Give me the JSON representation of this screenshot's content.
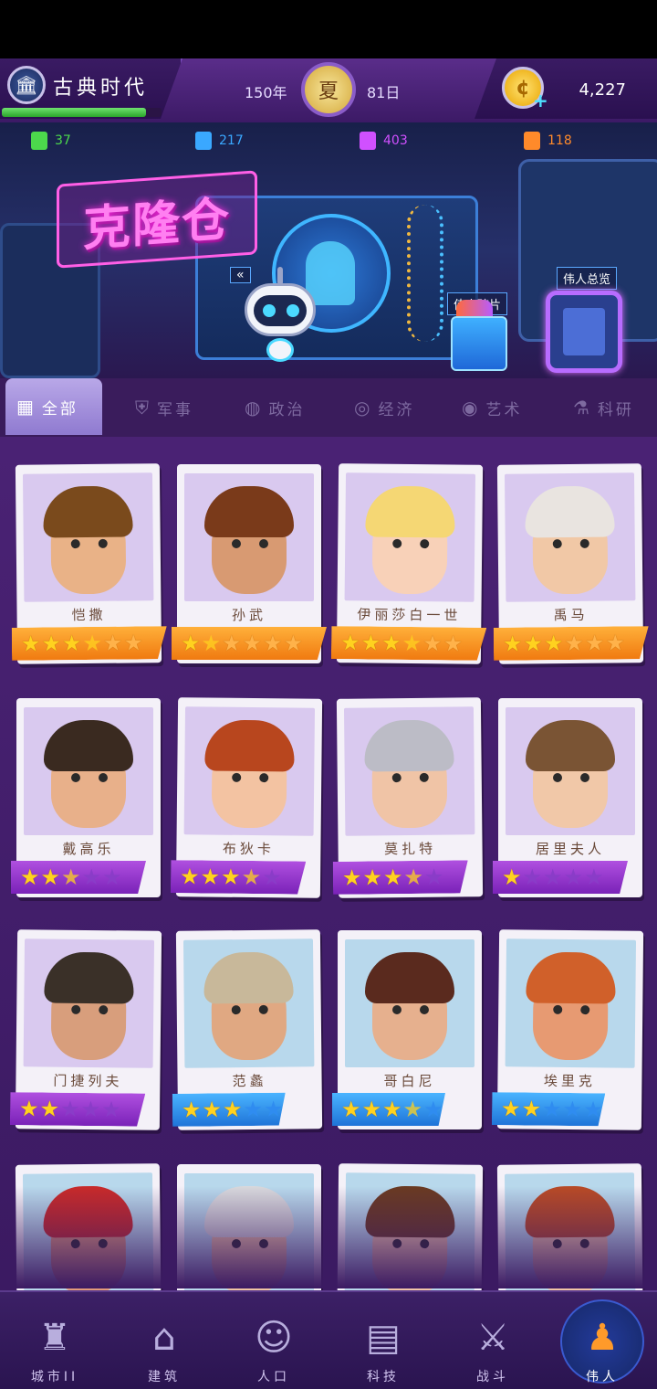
{
  "header": {
    "era_name": "古典时代",
    "era_progress": 0.9,
    "year": "150年",
    "season": "夏",
    "day": "81日",
    "coins": "4,227"
  },
  "resources": [
    {
      "value": "37",
      "color": "#4cd84c"
    },
    {
      "value": "217",
      "color": "#3aa8ff"
    },
    {
      "value": "403",
      "color": "#d050ff"
    },
    {
      "value": "118",
      "color": "#ff8a2a"
    }
  ],
  "banner": {
    "title": "克隆仓",
    "fragment_label": "伟人碎片",
    "overview_label": "伟人总览",
    "robot_chip": "«"
  },
  "tabs": [
    {
      "label": "全部",
      "icon": "grid-icon"
    },
    {
      "label": "军事",
      "icon": "shield-icon"
    },
    {
      "label": "政治",
      "icon": "globe-icon"
    },
    {
      "label": "经济",
      "icon": "coins-icon"
    },
    {
      "label": "艺术",
      "icon": "palette-icon"
    },
    {
      "label": "科研",
      "icon": "microscope-icon"
    }
  ],
  "heroes": [
    {
      "name": "恺撒",
      "tier": "orange",
      "stars": 3.5,
      "hair": "#7a4a1c",
      "skin": "#e9b287",
      "bg": "#d9c9ef"
    },
    {
      "name": "孙武",
      "tier": "orange",
      "stars": 1.5,
      "hair": "#7a3a1a",
      "skin": "#d89a72",
      "bg": "#d9c9ef"
    },
    {
      "name": "伊丽莎白一世",
      "tier": "orange",
      "stars": 3.5,
      "hair": "#f5d774",
      "skin": "#f8d1b8",
      "bg": "#d9c9ef"
    },
    {
      "name": "禹马",
      "tier": "orange",
      "stars": 3,
      "hair": "#e9e4e0",
      "skin": "#f1c8a6",
      "bg": "#d9c9ef"
    },
    {
      "name": "戴高乐",
      "tier": "purple",
      "stars": 2.5,
      "hair": "#3a2a20",
      "skin": "#e8b08a",
      "bg": "#d9c9ef"
    },
    {
      "name": "布狄卡",
      "tier": "purple",
      "stars": 3.5,
      "hair": "#b8461e",
      "skin": "#f3c3a2",
      "bg": "#d9c9ef"
    },
    {
      "name": "莫扎特",
      "tier": "purple",
      "stars": 3.5,
      "hair": "#bcbcc6",
      "skin": "#f0c4a6",
      "bg": "#d9c9ef"
    },
    {
      "name": "居里夫人",
      "tier": "purple",
      "stars": 1,
      "hair": "#7a5434",
      "skin": "#f1c8a8",
      "bg": "#d9c9ef"
    },
    {
      "name": "门捷列夫",
      "tier": "purple",
      "stars": 2,
      "hair": "#3a3028",
      "skin": "#d89e7c",
      "bg": "#d9c9ef"
    },
    {
      "name": "范蠡",
      "tier": "blue",
      "stars": 3,
      "hair": "#c8b89a",
      "skin": "#e0a882",
      "bg": "#b8d8ec"
    },
    {
      "name": "哥白尼",
      "tier": "blue",
      "stars": 3.5,
      "hair": "#5a2a1e",
      "skin": "#e6b08e",
      "bg": "#b8d8ec"
    },
    {
      "name": "埃里克",
      "tier": "blue",
      "stars": 2,
      "hair": "#d0602a",
      "skin": "#e79a72",
      "bg": "#b8d8ec"
    },
    {
      "name": "",
      "tier": "none",
      "stars": 0,
      "hair": "#c82a2a",
      "skin": "#e39a7a",
      "bg": "#b8d8ec"
    },
    {
      "name": "",
      "tier": "none",
      "stars": 0,
      "hair": "#d8d8dc",
      "skin": "#f0c4a4",
      "bg": "#b8d8ec"
    },
    {
      "name": "",
      "tier": "none",
      "stars": 0,
      "hair": "#6a3a22",
      "skin": "#f1c4a8",
      "bg": "#b8d8ec"
    },
    {
      "name": "",
      "tier": "none",
      "stars": 0,
      "hair": "#b84a26",
      "skin": "#f1c4a6",
      "bg": "#b8d8ec"
    }
  ],
  "nav": [
    {
      "label": "城市II",
      "icon": "castle-icon",
      "glyph": "♜"
    },
    {
      "label": "建筑",
      "icon": "house-icon",
      "glyph": "⌂"
    },
    {
      "label": "人口",
      "icon": "person-icon",
      "glyph": "☺"
    },
    {
      "label": "科技",
      "icon": "book-icon",
      "glyph": "▤"
    },
    {
      "label": "战斗",
      "icon": "swords-icon",
      "glyph": "⚔"
    },
    {
      "label": "伟人",
      "icon": "bust-icon",
      "glyph": "♟"
    }
  ]
}
